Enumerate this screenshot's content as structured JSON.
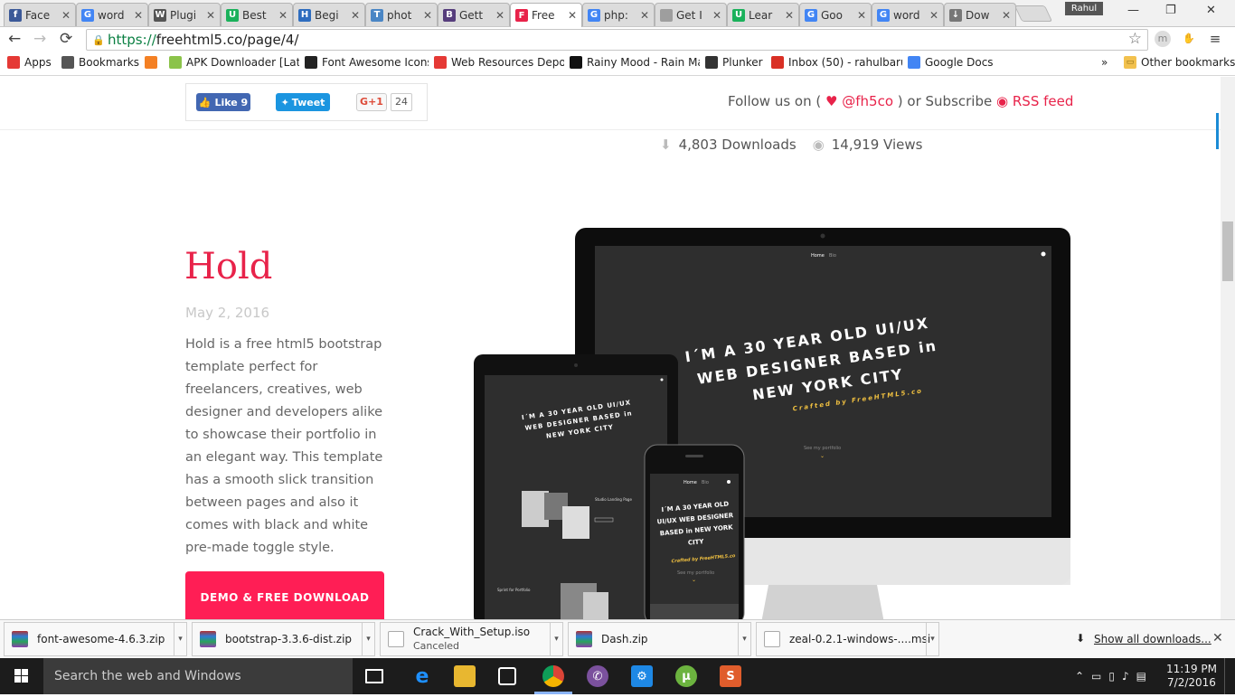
{
  "browser": {
    "tabs": [
      {
        "label": "Face",
        "icon": "facebook-icon",
        "color": "#3b5998",
        "glyph": "f"
      },
      {
        "label": "word",
        "icon": "google-icon",
        "color": "#4285f4",
        "glyph": "G"
      },
      {
        "label": "Plugi",
        "icon": "wikipedia-icon",
        "color": "#555555",
        "glyph": "W"
      },
      {
        "label": "Best",
        "icon": "u-icon",
        "color": "#1ab15b",
        "glyph": "U"
      },
      {
        "label": "Begi",
        "icon": "h-icon",
        "color": "#2e6dbf",
        "glyph": "H"
      },
      {
        "label": "phot",
        "icon": "t-icon",
        "color": "#4a86c5",
        "glyph": "T"
      },
      {
        "label": "Gett",
        "icon": "bootstrap-icon",
        "color": "#563d7c",
        "glyph": "B"
      },
      {
        "label": "Free",
        "icon": "freehtml5-icon",
        "color": "#e8234a",
        "glyph": "F"
      },
      {
        "label": "php:",
        "icon": "google-icon",
        "color": "#4285f4",
        "glyph": "G"
      },
      {
        "label": "Get I",
        "icon": "page-icon",
        "color": "#9e9e9e",
        "glyph": ""
      },
      {
        "label": "Lear",
        "icon": "u-icon",
        "color": "#1ab15b",
        "glyph": "U"
      },
      {
        "label": "Goo",
        "icon": "google-icon",
        "color": "#4285f4",
        "glyph": "G"
      },
      {
        "label": "word",
        "icon": "google-icon",
        "color": "#4285f4",
        "glyph": "G"
      },
      {
        "label": "Dow",
        "icon": "download-icon",
        "color": "#777777",
        "glyph": "↓"
      }
    ],
    "active_tab_index": 7,
    "profile_name": "Rahul",
    "address": {
      "scheme": "https://",
      "rest": "freehtml5.co/page/4/"
    },
    "bookmarks": [
      {
        "label": "Apps",
        "icon": "apps-icon",
        "color": "#e53935"
      },
      {
        "label": "Bookmarks",
        "icon": "star-icon",
        "color": "#555555"
      },
      {
        "label": "",
        "icon": "stackoverflow-icon",
        "color": "#f48024"
      },
      {
        "label": "APK Downloader [Late",
        "icon": "apk-icon",
        "color": "#8bc34a"
      },
      {
        "label": "Font Awesome Icons",
        "icon": "flag-icon",
        "color": "#222222"
      },
      {
        "label": "Web Resources Depot",
        "icon": "wrd-icon",
        "color": "#e53935"
      },
      {
        "label": "Rainy Mood - Rain Ma",
        "icon": "r-icon",
        "color": "#111111"
      },
      {
        "label": "Plunker",
        "icon": "plunker-icon",
        "color": "#333333"
      },
      {
        "label": "Inbox (50) - rahulbaru",
        "icon": "gmail-icon",
        "color": "#d93025"
      },
      {
        "label": "Google Docs",
        "icon": "docs-icon",
        "color": "#4285f4"
      }
    ],
    "bookmarks_overflow": "»",
    "other_bookmarks": "Other bookmarks"
  },
  "page": {
    "share": {
      "like_label": "Like 9",
      "tweet_label": "Tweet",
      "gplus_label": "G+1",
      "gplus_count": "24"
    },
    "follow": {
      "prefix": "Follow us on (",
      "handle": "@fh5co",
      "mid": ") or Subscribe",
      "rss": "RSS feed"
    },
    "stats": {
      "downloads": "4,803 Downloads",
      "views": "14,919 Views"
    },
    "item": {
      "title": "Hold",
      "date": "May 2, 2016",
      "description": "Hold is a free html5 bootstrap template perfect for freelancers, creatives, web designer and developers alike to showcase their portfolio in an elegant way. This template has a smooth slick transition between pages and also it comes with black and white pre-made toggle style.",
      "button": "DEMO & FREE DOWNLOAD"
    },
    "mockup": {
      "nav_home": "Home",
      "nav_bio": "Bio",
      "headline_1": "I´M A 30 YEAR OLD UI/UX",
      "headline_2": "WEB DESIGNER BASED in",
      "headline_3": "NEW YORK CITY",
      "credit": "Crafted by FreeHTML5.co",
      "see": "See my portfolio",
      "phone_headline_1": "I´M A 30 YEAR OLD",
      "phone_headline_2": "UI/UX WEB DESIGNER",
      "phone_headline_3": "BASED in NEW YORK",
      "phone_headline_4": "CITY",
      "tablet_headline_1": "I´M A 30 YEAR OLD UI/UX",
      "tablet_headline_2": "WEB DESIGNER BASED in",
      "tablet_headline_3": "NEW YORK CITY",
      "tablet_card_1": "Studio Landing Page",
      "tablet_card_2": "Sprint for Portfolio"
    }
  },
  "downloads": [
    {
      "name": "font-awesome-4.6.3.zip",
      "status": ""
    },
    {
      "name": "bootstrap-3.3.6-dist.zip",
      "status": ""
    },
    {
      "name": "Crack_With_Setup.iso",
      "status": "Canceled"
    },
    {
      "name": "Dash.zip",
      "status": ""
    },
    {
      "name": "zeal-0.2.1-windows-....msi",
      "status": ""
    }
  ],
  "show_all_downloads": "Show all downloads...",
  "taskbar": {
    "search_placeholder": "Search the web and Windows",
    "time": "11:19 PM",
    "date": "7/2/2016"
  },
  "colors": {
    "accent": "#e8234a",
    "button": "#ff1e55"
  }
}
